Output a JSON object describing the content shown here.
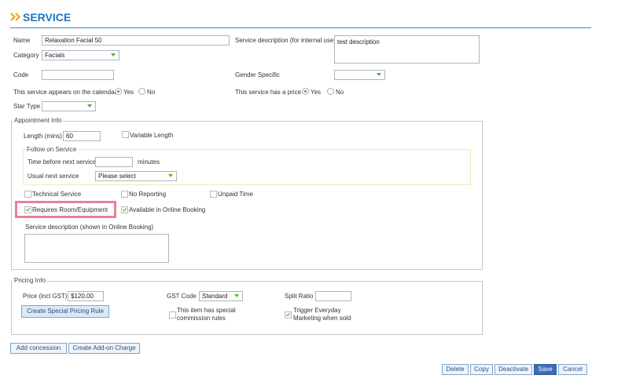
{
  "header": {
    "title": "SERVICE"
  },
  "form": {
    "name_label": "Name",
    "name_value": "Relaxation Facial 50",
    "category_label": "Category",
    "category_value": "Facials",
    "code_label": "Code",
    "code_value": "",
    "calendar_label": "This service appears on the calendar",
    "yes": "Yes",
    "no": "No",
    "star_label": "Star Type",
    "star_value": "",
    "desc_label": "Service description (for internal use)",
    "desc_value": "test description",
    "gender_label": "Gender Specific",
    "gender_value": "",
    "price_flag_label": "This service has a price"
  },
  "appointment": {
    "legend": "Appointment Info",
    "length_label": "Length (mins)",
    "length_value": "60",
    "variable_label": "Variable Length",
    "follow_legend": "Follow on Service",
    "time_before_label": "Time before next service",
    "time_before_value": "",
    "minutes": "minutes",
    "usual_label": "Usual next service",
    "usual_value": "Please select",
    "technical_label": "Technical Service",
    "no_reporting_label": "No Reporting",
    "unpaid_label": "Unpaid Time",
    "room_label": "Requires Room/Equipment",
    "online_label": "Available in Online Booking",
    "online_desc_label": "Service description (shown in Online Booking)",
    "online_desc_value": ""
  },
  "pricing": {
    "legend": "Pricing Info",
    "price_label": "Price (incl GST)",
    "price_value": "$120.00",
    "gst_label": "GST Code",
    "gst_value": "Standard",
    "split_label": "Split Ratio",
    "split_value": "",
    "special_rule_button": "Create Special Pricing Rule",
    "commission_label": "This item has special commission rules",
    "trigger_label": "Trigger Everyday Marketing when sold"
  },
  "actions": {
    "add_concession": "Add concession",
    "create_addon": "Create Add-on Charge",
    "delete": "Delete",
    "copy": "Copy",
    "deactivate": "Deactivate",
    "save": "Save",
    "cancel": "Cancel"
  },
  "colors": {
    "accent": "#1f74c4",
    "brand_arrow": "#f2a21b",
    "highlight": "#e8819b",
    "check_green": "#4fa52a"
  }
}
